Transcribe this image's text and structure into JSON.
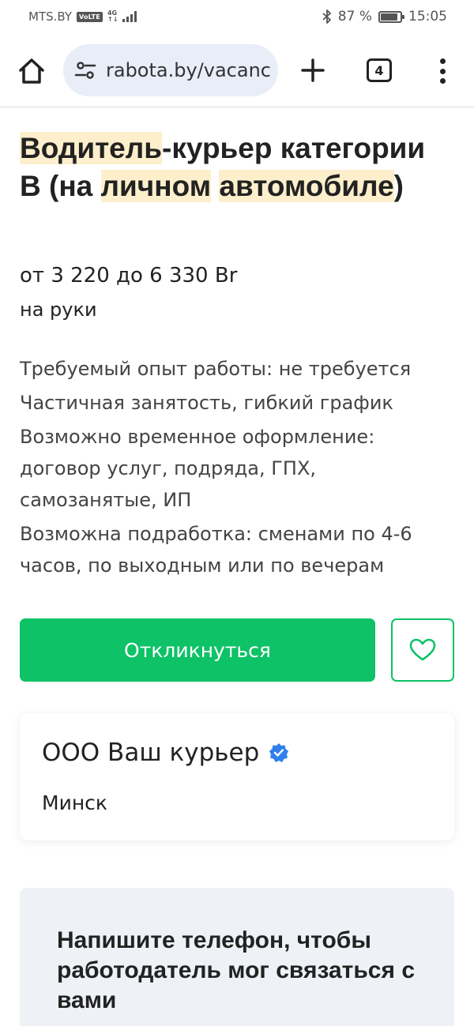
{
  "status_bar": {
    "carrier": "MTS.BY",
    "volte": "VoLTE",
    "network_top": "4G",
    "network_bottom": "↑↓",
    "battery_percent": "87 %",
    "battery_level": 0.87,
    "time": "15:05"
  },
  "browser": {
    "url": "rabota.by/vacanc",
    "tab_count": "4"
  },
  "vacancy": {
    "title_part1": "Водитель",
    "title_part2": "-курьер категории B (на ",
    "title_part3": "личном",
    "title_part4": " ",
    "title_part5": "автомобиле",
    "title_part6": ")",
    "salary": "от 3 220 до 6 330 Br",
    "salary_note": "на руки",
    "details": [
      "Требуемый опыт работы: не требуется",
      "Частичная занятость, гибкий график",
      "Возможно временное оформление: договор услуг, подряда, ГПХ, самозанятые, ИП",
      "Возможна подработка: сменами по 4-6 часов, по выходным или по вечерам"
    ],
    "respond_label": "Откликнуться"
  },
  "company": {
    "name": "ООО Ваш курьер",
    "city": "Минск"
  },
  "phone_prompt": {
    "title": "Напишите телефон, чтобы работодатель мог связаться с вами"
  },
  "colors": {
    "accent_green": "#0dc267",
    "highlight": "#fdefcb",
    "verified_blue": "#2f80ed"
  }
}
